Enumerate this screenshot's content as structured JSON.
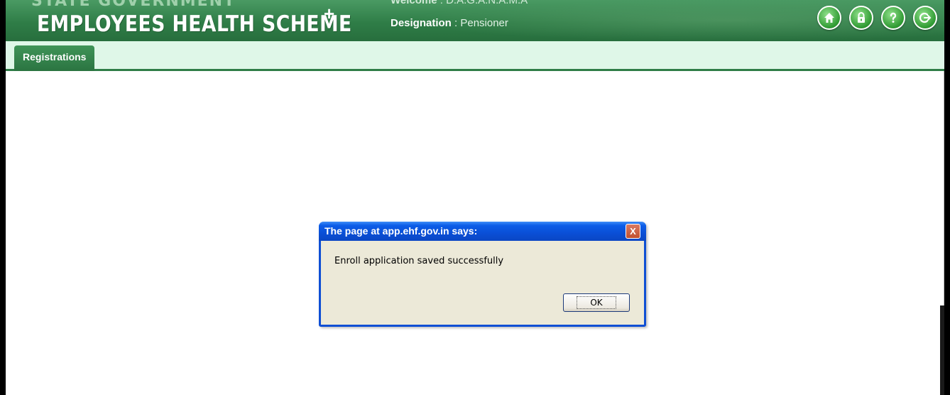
{
  "header": {
    "brand_top": "STATE GOVERNMENT",
    "brand_main": "EMPLOYEES HEALTH SCHEME",
    "brand_plus": "+",
    "welcome_label": "Welcome",
    "welcome_value": ": D.A.G.A.N.A.M.A",
    "designation_label": "Designation",
    "designation_value": ": Pensioner",
    "icons": [
      "home-icon",
      "lock-icon",
      "help-icon",
      "logout-icon"
    ]
  },
  "tabs": [
    {
      "label": "Registrations"
    }
  ],
  "dialog": {
    "title": "The page at app.ehf.gov.in says:",
    "close_label": "X",
    "message": "Enroll application saved successfully",
    "ok_label": "OK"
  },
  "colors": {
    "header_green": "#2f7d47",
    "tabbar_bg": "#dff7e8",
    "dialog_title_blue": "#0a4fd6"
  }
}
